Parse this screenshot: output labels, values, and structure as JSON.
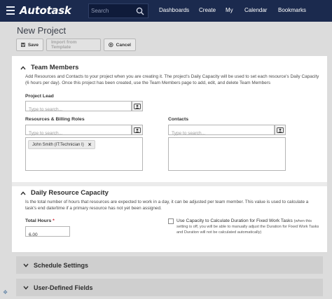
{
  "app": {
    "logo": "Autotask",
    "search_placeholder": "Search",
    "nav": [
      "Dashboards",
      "Create",
      "My",
      "Calendar",
      "Bookmarks"
    ]
  },
  "page": {
    "title": "New Project",
    "buttons": {
      "save": "Save",
      "import": "Import from Template",
      "cancel": "Cancel"
    }
  },
  "team": {
    "heading": "Team Members",
    "description": "Add Resources and Contacts to your project when you are creating it. The project's Daily Capacity will be used to set each resource's Daily Capacity (6 hours per day). Once this project has been created, use the Team Members page to add, edit, and delete Team Members",
    "lead_label": "Project Lead",
    "lead_placeholder": "Type to search...",
    "roles_label": "Resources & Billing Roles",
    "roles_placeholder": "Type to search...",
    "roles_selected": "John Smith (IT:Technician I)",
    "contacts_label": "Contacts",
    "contacts_placeholder": "Type to search..."
  },
  "capacity": {
    "heading": "Daily Resource Capacity",
    "description": "Is the total number of hours that resources are expected to work in a day, it can be adjusted per team member. This value is used to calculate a task's end date/time if a primary resource has not yet been assigned.",
    "hours_label": "Total Hours",
    "hours_required": "*",
    "hours_value": "6.00",
    "checkbox_label": "Use Capacity to Calculate Duration for Fixed Work Tasks",
    "checkbox_note": "(when this setting is off, you will be able to manually adjust the Duration for Fixed Work Tasks and Duration will not be calculated automatically)",
    "checkbox_checked": false
  },
  "collapsed_sections": [
    "Schedule Settings",
    "User-Defined Fields"
  ],
  "colors": {
    "topbar": "#1b2a4e",
    "panel": "#ffffff",
    "background": "#dcdcdc"
  }
}
